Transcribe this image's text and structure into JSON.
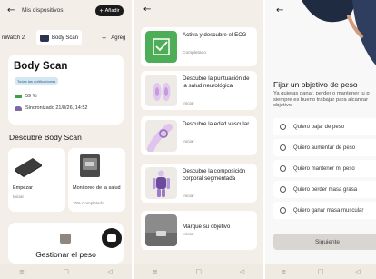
{
  "panel1": {
    "title": "Mis dispositivos",
    "add_label": "Añadir",
    "tabs": [
      "nWatch 2",
      "Body Scan",
      "Agreg"
    ],
    "scan_card": {
      "title": "Body Scan",
      "chip": "Todas las notificaciones",
      "battery": "59 %",
      "sync": "Sincronizado 21/8/26, 14:52"
    },
    "section_title": "Descubre Body Scan",
    "cards": [
      {
        "title": "Empezar",
        "sub": "Iniciar"
      },
      {
        "title": "Monitoreo de la salud",
        "sub": "20% Completado"
      }
    ],
    "bottom_card_title": "Gestionar el peso"
  },
  "panel2": {
    "items": [
      {
        "title": "Activa y descubre el ECG",
        "sub": "Completado"
      },
      {
        "title": "Descubre la puntuación de la salud neurológica",
        "sub": "Iniciar"
      },
      {
        "title": "Descubre la edad vascular",
        "sub": "Iniciar"
      },
      {
        "title": "Descubre la composición corporal segmentada",
        "sub": "Iniciar"
      },
      {
        "title": "Marque su objetivo",
        "sub": "Iniciar"
      }
    ]
  },
  "panel3": {
    "heading": "Fijar un objetivo de peso",
    "description": "Ya quieras ganar, perder o mantener tu p siempre es bueno trabajar para alcanzar objetivo.",
    "options": [
      "Quiero bajar de peso",
      "Quiero aumentar de peso",
      "Quiero mantener mi peso",
      "Quiero perder masa grasa",
      "Quiero ganar masa muscular"
    ],
    "next_label": "Siguiente"
  },
  "icons": {
    "back": "back-arrow-icon",
    "plus": "plus-icon",
    "chat": "chat-bubble-icon",
    "nav": [
      "menu-icon",
      "home-icon",
      "back-icon"
    ]
  },
  "colors": {
    "background": "#f3eee7",
    "ecg_green": "#4eae58",
    "body_purple": "#a88ec7",
    "dark": "#1b1b1b"
  }
}
